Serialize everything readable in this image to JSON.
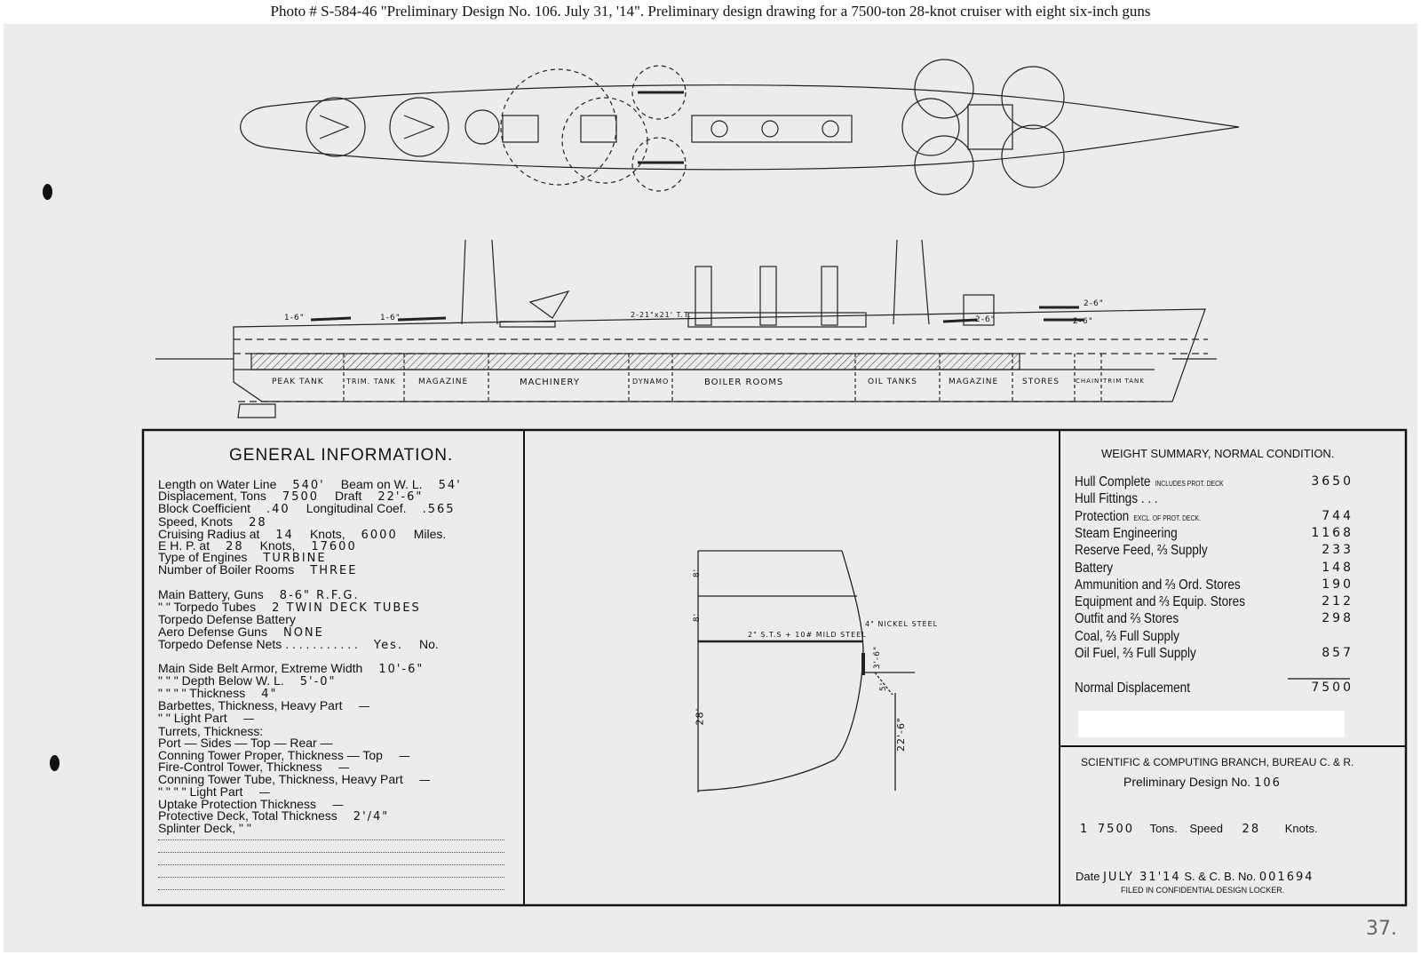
{
  "caption": "Photo #  S-584-46     \"Preliminary Design No. 106.  July 31, '14\".  Preliminary design drawing for a 7500-ton 28-knot cruiser with eight six-inch guns",
  "profile_labels": {
    "gun1": "1-6\"",
    "gun2": "1-6\"",
    "tt": "2-21\"x21' T.T.",
    "gun3": "2-6\"",
    "gun4": "2-6\"",
    "gun5": "2-6\"",
    "compartments": [
      "PEAK TANK",
      "TRIM. TANK",
      "MAGAZINE",
      "MACHINERY",
      "DYNAMO",
      "BOILER ROOMS",
      "OIL TANKS",
      "MAGAZINE",
      "STORES",
      "CHAIN",
      "TRIM TANK"
    ]
  },
  "general": {
    "title": "GENERAL INFORMATION.",
    "lines": [
      {
        "label": "Length on Water Line",
        "value": "540'",
        "label2": "Beam on W. L.",
        "value2": "54'"
      },
      {
        "label": "Displacement, Tons",
        "value": "7500",
        "label2": "Draft",
        "value2": "22'-6\""
      },
      {
        "label": "Block Coefficient",
        "value": ".40",
        "label2": "Longitudinal Coef.",
        "value2": ".565"
      },
      {
        "label": "Speed, Knots",
        "value": "28"
      },
      {
        "label": "Cruising Radius at",
        "value": "14",
        "label2": "Knots,",
        "value2": "6000",
        "suffix": "Miles."
      },
      {
        "label": "E H. P. at",
        "value": "28",
        "label2": "Knots,",
        "value2": "17600"
      },
      {
        "label": "Type of Engines",
        "value": "TURBINE"
      },
      {
        "label": "Number of Boiler Rooms",
        "value": "THREE"
      },
      {
        "label": "Main Battery, Guns",
        "value": "8-6\" R.F.G."
      },
      {
        "label": "\"       \"     Torpedo Tubes",
        "value": "2 TWIN DECK TUBES"
      },
      {
        "label": "Torpedo Defense Battery",
        "value": ""
      },
      {
        "label": "Aero Defense Guns",
        "value": "NONE"
      },
      {
        "label": "Torpedo Defense Nets . . . . . . . . . . .",
        "value": "Yes.",
        "suffix": "No."
      },
      {
        "label": "Main Side Belt Armor, Extreme Width",
        "value": "10'-6\""
      },
      {
        "label": "\"      \"     \"     Depth Below W. L.",
        "value": "5'-0\""
      },
      {
        "label": "\"      \"     \"     \"     Thickness",
        "value": "4\""
      },
      {
        "label": "Barbettes, Thickness, Heavy Part",
        "value": "—"
      },
      {
        "label": "\"       \"     Light Part",
        "value": "—"
      },
      {
        "label": "Turrets, Thickness:",
        "value": ""
      },
      {
        "label": "Port  —   Sides  —   Top  —   Rear  —",
        "value": ""
      },
      {
        "label": "Conning Tower Proper, Thickness   —   Top",
        "value": "—"
      },
      {
        "label": "Fire-Control Tower, Thickness",
        "value": "—"
      },
      {
        "label": "Conning Tower Tube, Thickness, Heavy Part",
        "value": "—"
      },
      {
        "label": "\"     \"     \"     \"     Light Part",
        "value": "—"
      },
      {
        "label": "Uptake Protection Thickness",
        "value": "—"
      },
      {
        "label": "Protective Deck, Total Thickness",
        "value": "2'/4\""
      },
      {
        "label": "Splinter Deck,   \"         \"",
        "value": ""
      }
    ]
  },
  "section_labels": {
    "d8a": "8'",
    "d8b": "8'",
    "d28": "28'",
    "d3_6": "3'-6\"",
    "d5": "5'",
    "d22_6": "22'-6\"",
    "deck": "2\" S.T.S + 10# MILD STEEL",
    "nickel": "4\" NICKEL STEEL"
  },
  "weights": {
    "title": "WEIGHT SUMMARY, NORMAL CONDITION.",
    "rows": [
      {
        "label": "Hull Complete",
        "note": "INCLUDES PROT. DECK",
        "value": "3650"
      },
      {
        "label": "Hull Fittings  .  .  .",
        "value": ""
      },
      {
        "label": "Protection",
        "note": "EXCL. OF PROT. DECK.",
        "value": "744"
      },
      {
        "label": "Steam Engineering",
        "value": "1168"
      },
      {
        "label": "Reserve Feed, ⅔ Supply",
        "value": "233"
      },
      {
        "label": "Battery",
        "value": "148"
      },
      {
        "label": "Ammunition and ⅔ Ord. Stores",
        "value": "190"
      },
      {
        "label": "Equipment and ⅔ Equip. Stores",
        "value": "212"
      },
      {
        "label": "Outfit and ⅔ Stores",
        "value": "298"
      },
      {
        "label": "Coal, ⅔ Full Supply",
        "value": ""
      },
      {
        "label": "Oil Fuel, ⅔ Full Supply",
        "value": "857"
      }
    ],
    "normal_label": "Normal Displacement",
    "normal_value": "7500"
  },
  "branch": {
    "line1": "SCIENTIFIC & COMPUTING BRANCH, BUREAU C. & R.",
    "line2": "Preliminary Design No.",
    "design_no": "106",
    "tons_prefix": "1",
    "tons": "7500",
    "tons_label": "Tons.",
    "speed_label": "Speed",
    "speed": "28",
    "knots_label": "Knots.",
    "date_label": "Date",
    "date": "JULY 31'14",
    "scb_label": "S. & C. B. No.",
    "scb_no": "001694",
    "filed": "FILED IN CONFIDENTIAL DESIGN LOCKER."
  },
  "page_mark": "37."
}
